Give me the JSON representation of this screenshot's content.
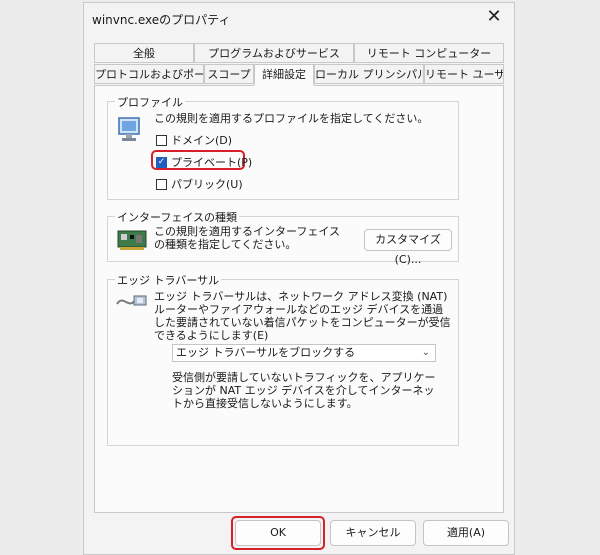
{
  "window": {
    "title": "winvnc.exeのプロパティ",
    "close_glyph": "✕"
  },
  "tabs": {
    "row1": [
      "全般",
      "プログラムおよびサービス",
      "リモート コンピューター"
    ],
    "row2": [
      "プロトコルおよびポート",
      "スコープ",
      "詳細設定",
      "ローカル プリンシパル",
      "リモート ユーザー"
    ],
    "active": "詳細設定"
  },
  "profiles": {
    "legend": "プロファイル",
    "description": "この規則を適用するプロファイルを指定してください。",
    "options": [
      {
        "label": "ドメイン(D)",
        "checked": false
      },
      {
        "label": "プライベート(P)",
        "checked": true
      },
      {
        "label": "パブリック(U)",
        "checked": false
      }
    ]
  },
  "interfaces": {
    "legend": "インターフェイスの種類",
    "description": "この規則を適用するインターフェイスの種類を指定してください。",
    "customize_label": "カスタマイズ(C)..."
  },
  "edge": {
    "legend": "エッジ トラバーサル",
    "description": "エッジ トラバーサルは、ネットワーク アドレス変換 (NAT) ルーターやファイアウォールなどのエッジ デバイスを通過した要請されていない着信パケットをコンピューターが受信できるようにします(E)",
    "select_value": "エッジ トラバーサルをブロックする",
    "help": "受信側が要請していないトラフィックを、アプリケーションが NAT エッジ デバイスを介してインターネットから直接受信しないようにします。"
  },
  "footer": {
    "ok": "OK",
    "cancel": "キャンセル",
    "apply": "適用(A)"
  },
  "colors": {
    "highlight": "#d8202a",
    "check_accent": "#1f5fbf"
  }
}
